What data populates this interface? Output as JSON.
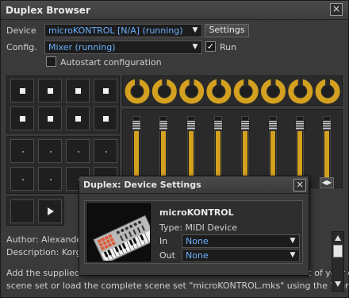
{
  "window": {
    "title": "Duplex Browser",
    "close_glyph": "×"
  },
  "device": {
    "label": "Device",
    "value": "microKONTROL [N/A] (running)",
    "settings_label": "Settings"
  },
  "config": {
    "label": "Config.",
    "value": "Mixer (running)",
    "run_label": "Run",
    "run_checked": true
  },
  "autostart": {
    "label": "Autostart configuration",
    "checked": false
  },
  "controller": {
    "pad_rows_top": 2,
    "pad_cols": 4,
    "knob_count": 8,
    "fader_count": 8,
    "fader_levels": [
      1.0,
      1.0,
      1.0,
      1.0,
      1.0,
      1.0,
      1.0,
      1.0
    ],
    "accent": "#d4a020"
  },
  "info": {
    "author": "Author: Alexander",
    "description": "Description: Korg m",
    "body_line1": "Add the supplied scene data file \"microKONTROL.mka\" into a free slot of your own",
    "body_line2": "scene set or load the complete scene set \"microKONTROL.mks\" using the \"Korg"
  },
  "dialog": {
    "title": "Duplex: Device Settings",
    "close_glyph": "×",
    "device_name": "microKONTROL",
    "type": "Type: MIDI Device",
    "in_label": "In",
    "in_value": "None",
    "out_label": "Out",
    "out_value": "None"
  }
}
